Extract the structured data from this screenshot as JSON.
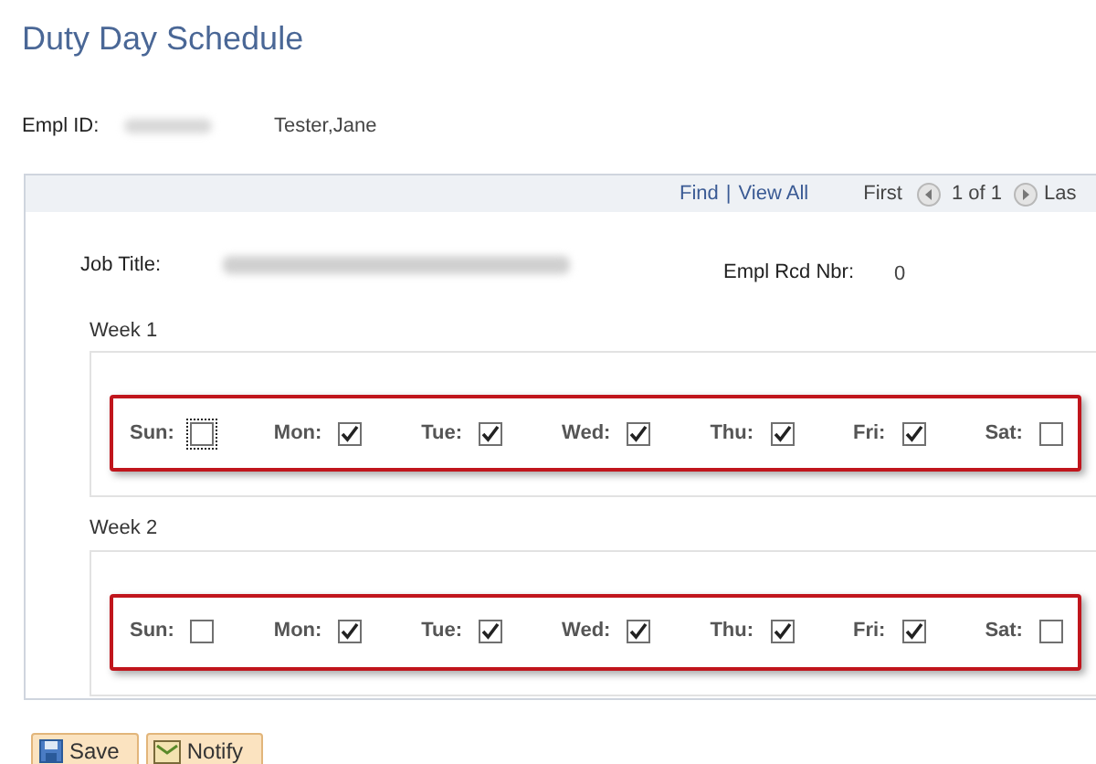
{
  "page_title": "Duty Day Schedule",
  "employee": {
    "id_label": "Empl ID:",
    "name": "Tester,Jane"
  },
  "navigation": {
    "find": "Find",
    "separator": "|",
    "view_all": "View All",
    "first": "First",
    "count": "1 of 1",
    "last": "Las"
  },
  "job": {
    "title_label": "Job Title:",
    "rcd_label": "Empl Rcd Nbr:",
    "rcd_value": "0"
  },
  "weeks": [
    {
      "label": "Week 1",
      "days": [
        {
          "label": "Sun:",
          "checked": false,
          "focused": true
        },
        {
          "label": "Mon:",
          "checked": true,
          "focused": false
        },
        {
          "label": "Tue:",
          "checked": true,
          "focused": false
        },
        {
          "label": "Wed:",
          "checked": true,
          "focused": false
        },
        {
          "label": "Thu:",
          "checked": true,
          "focused": false
        },
        {
          "label": "Fri:",
          "checked": true,
          "focused": false
        },
        {
          "label": "Sat:",
          "checked": false,
          "focused": false
        }
      ]
    },
    {
      "label": "Week 2",
      "days": [
        {
          "label": "Sun:",
          "checked": false,
          "focused": false
        },
        {
          "label": "Mon:",
          "checked": true,
          "focused": false
        },
        {
          "label": "Tue:",
          "checked": true,
          "focused": false
        },
        {
          "label": "Wed:",
          "checked": true,
          "focused": false
        },
        {
          "label": "Thu:",
          "checked": true,
          "focused": false
        },
        {
          "label": "Fri:",
          "checked": true,
          "focused": false
        },
        {
          "label": "Sat:",
          "checked": false,
          "focused": false
        }
      ]
    }
  ],
  "buttons": [
    {
      "kind": "save",
      "label": "Save"
    },
    {
      "kind": "notify",
      "label": "Notify"
    }
  ]
}
